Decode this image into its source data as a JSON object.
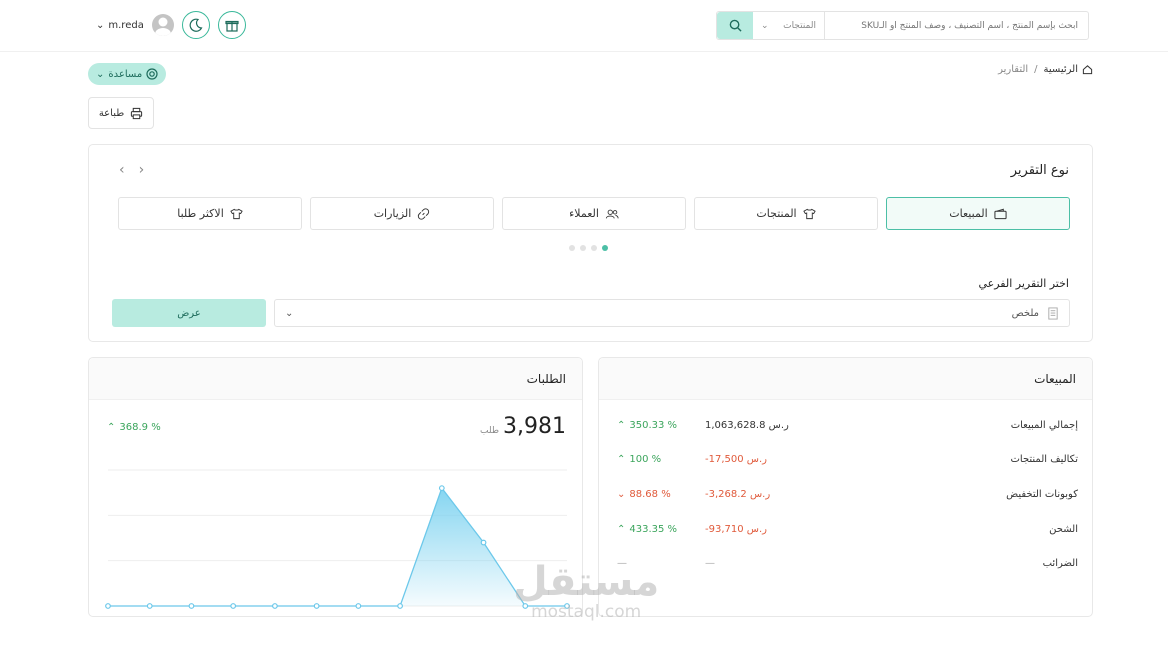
{
  "header": {
    "search_placeholder": "ابحث بإسم المنتج ، اسم التصنيف ، وصف المنتج أو الـSKU",
    "search_scope": "المنتجات",
    "username": "m.reda"
  },
  "breadcrumb": {
    "home": "الرئيسية",
    "separator": "/",
    "current": "التقارير"
  },
  "help_label": "مساعدة",
  "print_label": "طباعة",
  "report": {
    "title": "نوع التقرير",
    "tabs": [
      {
        "label": "المبيعات",
        "icon": "wallet-icon"
      },
      {
        "label": "المنتجات",
        "icon": "shirt-icon"
      },
      {
        "label": "العملاء",
        "icon": "users-icon"
      },
      {
        "label": "الزيارات",
        "icon": "link-icon"
      },
      {
        "label": "الاكثر طلبا",
        "icon": "shirt-icon"
      }
    ],
    "sub_label": "اختر التقرير الفرعي",
    "sub_value": "ملخص",
    "show_label": "عرض"
  },
  "sales": {
    "title": "المبيعات",
    "rows": [
      {
        "label": "إجمالي المبيعات",
        "value": "1,063,628.8 ر.س",
        "pct": "350.33 %",
        "trend": "up"
      },
      {
        "label": "تكاليف المنتجات",
        "value": "-17,500 ر.س",
        "pct": "100 %",
        "trend": "up"
      },
      {
        "label": "كوبونات التخفيض",
        "value": "-3,268.2 ر.س",
        "pct": "88.68 %",
        "trend": "down"
      },
      {
        "label": "الشحن",
        "value": "-93,710 ر.س",
        "pct": "433.35 %",
        "trend": "up"
      },
      {
        "label": "الضرائب",
        "value": "—",
        "pct": "—",
        "trend": "none"
      }
    ]
  },
  "orders": {
    "title": "الطلبات",
    "total": "3,981",
    "unit": "طلب",
    "pct": "368.9 %"
  },
  "chart_data": {
    "type": "area",
    "title": "",
    "xlabel": "",
    "ylabel": "",
    "values": [
      0,
      0,
      0,
      0,
      0,
      0,
      0,
      0,
      3.9,
      2.1,
      0,
      0
    ],
    "ylim": [
      0,
      4.5
    ],
    "grid": true,
    "color": "#7fd3f0"
  },
  "watermark": {
    "line1": "مستقل",
    "line2": "mostaql.com"
  },
  "colors": {
    "accent": "#b8ebe0",
    "accent_dark": "#4cbfa6",
    "up": "#3ba55c",
    "down": "#e05a3b"
  }
}
